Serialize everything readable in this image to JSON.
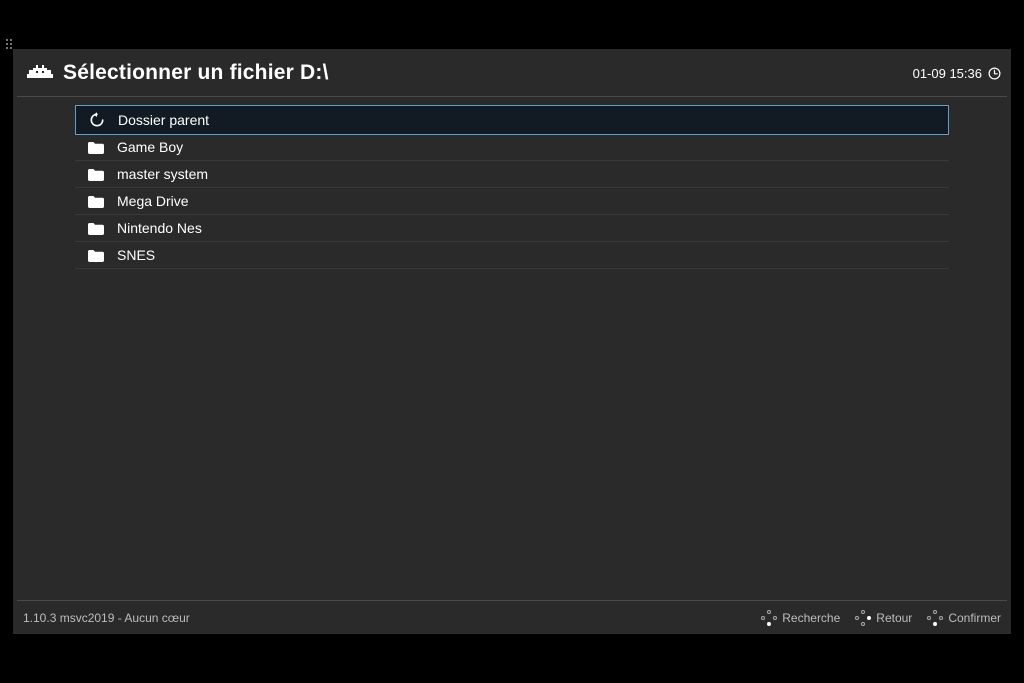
{
  "header": {
    "title": "Sélectionner un fichier D:\\",
    "datetime": "01-09 15:36"
  },
  "list": {
    "items": [
      {
        "icon": "back",
        "label": "Dossier parent",
        "selected": true
      },
      {
        "icon": "folder",
        "label": "Game Boy",
        "selected": false
      },
      {
        "icon": "folder",
        "label": "master system",
        "selected": false
      },
      {
        "icon": "folder",
        "label": "Mega Drive",
        "selected": false
      },
      {
        "icon": "folder",
        "label": "Nintendo Nes",
        "selected": false
      },
      {
        "icon": "folder",
        "label": "SNES",
        "selected": false
      }
    ]
  },
  "footer": {
    "status": "1.10.3 msvc2019 - Aucun cœur",
    "actions": [
      {
        "label": "Recherche"
      },
      {
        "label": "Retour"
      },
      {
        "label": "Confirmer"
      }
    ]
  }
}
